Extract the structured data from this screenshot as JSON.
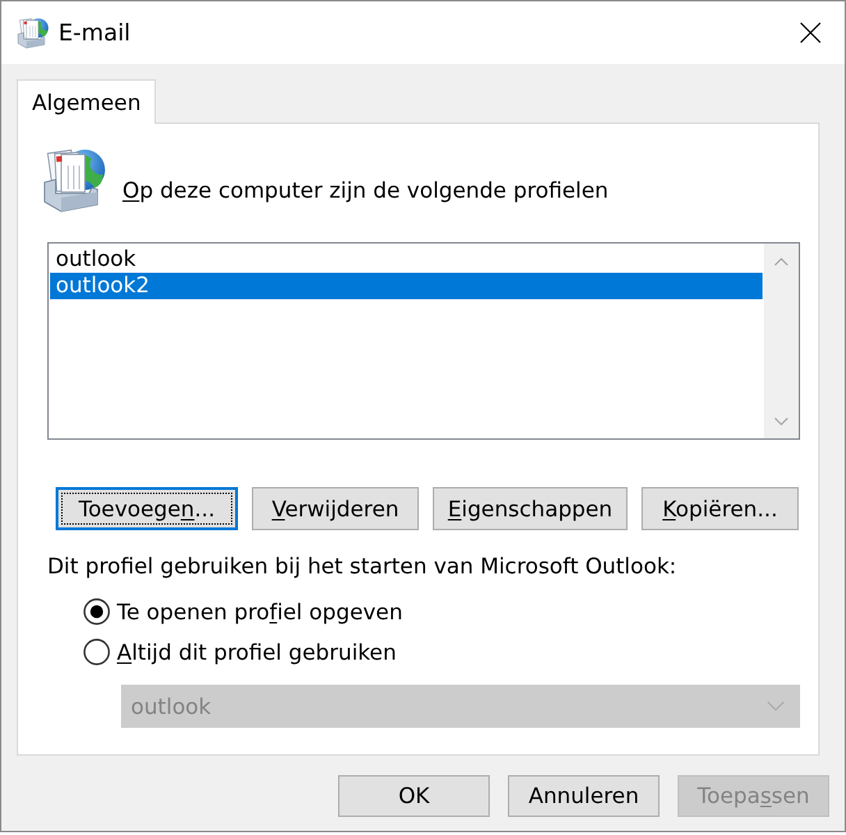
{
  "window": {
    "title": "E-mail"
  },
  "tabs": [
    {
      "label": "Algemeen",
      "selected": true
    }
  ],
  "profiles": {
    "heading": {
      "key": "O",
      "after": "p deze computer zijn de volgende profielen"
    },
    "items": [
      {
        "label": "outlook",
        "selected": false
      },
      {
        "label": "outlook2",
        "selected": true
      }
    ]
  },
  "profile_buttons": [
    {
      "label": {
        "before": "Toevoege",
        "key": "n",
        "after": "..."
      },
      "focused": true
    },
    {
      "label": {
        "key": "V",
        "after": "erwijderen"
      },
      "focused": false
    },
    {
      "label": {
        "key": "E",
        "after": "igenschappen"
      },
      "focused": false
    },
    {
      "label": {
        "key": "K",
        "after": "opiëren..."
      },
      "focused": false
    }
  ],
  "startup": {
    "label": "Dit profiel gebruiken bij het starten van Microsoft Outlook:",
    "options": [
      {
        "label": {
          "before": "Te openen pro",
          "key": "f",
          "after": "iel opgeven"
        },
        "selected": true
      },
      {
        "label": {
          "key": "A",
          "after": "ltijd dit profiel gebruiken"
        },
        "selected": false
      }
    ],
    "profile_select": {
      "value": "outlook",
      "disabled": true
    }
  },
  "dialog_buttons": [
    {
      "label": {
        "before": "OK"
      },
      "disabled": false
    },
    {
      "label": {
        "before": "Annuleren"
      },
      "disabled": false
    },
    {
      "label": {
        "before": "Toepa",
        "key": "s",
        "after": "sen"
      },
      "disabled": true
    }
  ]
}
